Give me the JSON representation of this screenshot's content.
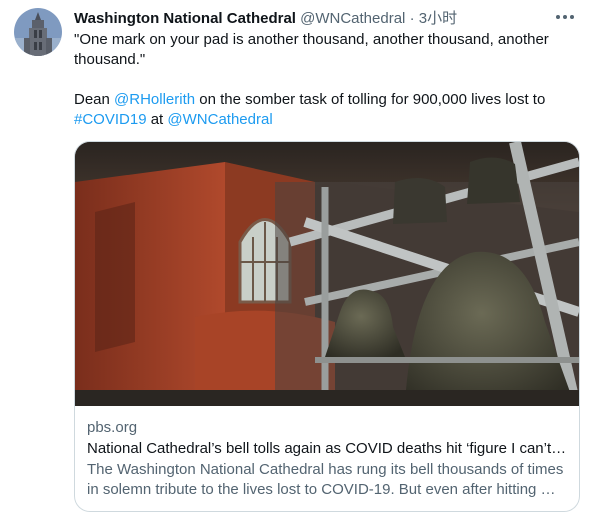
{
  "tweet": {
    "display_name": "Washington National Cathedral",
    "handle": "@WNCathedral",
    "separator": "·",
    "time": "3小时",
    "text_line1": "\"One mark on your pad is another thousand, another thousand, another thousand.\"",
    "text_pre": "Dean ",
    "mention1": "@RHollerith",
    "text_mid": " on the somber task of tolling for 900,000 lives lost to ",
    "hashtag": "#COVID19",
    "text_at": " at ",
    "mention2": "@WNCathedral",
    "avatar_icon": "cathedral-tower-avatar",
    "more_icon": "more-horizontal-icon"
  },
  "card": {
    "image_icon": "bell-tower-photo",
    "domain": "pbs.org",
    "title": "National Cathedral’s bell tolls again as COVID deaths hit ‘figure I can’t…",
    "description": "The Washington National Cathedral has rung its bell thousands of times in solemn tribute to the lives lost to COVID-19. But even after hitting …"
  },
  "colors": {
    "link": "#1d9bf0",
    "secondary_text": "#536471",
    "primary_text": "#0f1419",
    "border": "#cfd9de"
  }
}
